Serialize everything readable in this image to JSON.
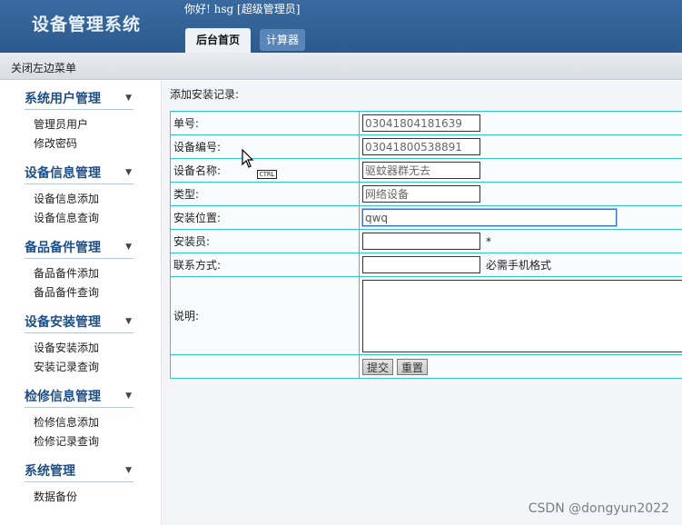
{
  "header": {
    "app_title": "设备管理系统",
    "greeting": "你好! hsg [超级管理员]",
    "tabs": [
      {
        "label": "后台首页"
      },
      {
        "label": "计算器"
      }
    ]
  },
  "toolbar": {
    "toggle_menu": "关闭左边菜单"
  },
  "sidebar": {
    "groups": [
      {
        "title": "系统用户管理",
        "items": [
          "管理员用户",
          "修改密码"
        ]
      },
      {
        "title": "设备信息管理",
        "items": [
          "设备信息添加",
          "设备信息查询"
        ]
      },
      {
        "title": "备品备件管理",
        "items": [
          "备品备件添加",
          "备品备件查询"
        ]
      },
      {
        "title": "设备安装管理",
        "items": [
          "设备安装添加",
          "安装记录查询"
        ]
      },
      {
        "title": "检修信息管理",
        "items": [
          "检修信息添加",
          "检修记录查询"
        ]
      },
      {
        "title": "系统管理",
        "items": [
          "数据备份"
        ]
      }
    ],
    "arrow": "▼"
  },
  "main": {
    "section_title": "添加安装记录:",
    "form": {
      "order_no": {
        "label": "单号:",
        "value": "03041804181639"
      },
      "device_no": {
        "label": "设备编号:",
        "value": "03041800538891"
      },
      "device_name": {
        "label": "设备名称:",
        "value": "驱蚊器群无去"
      },
      "type": {
        "label": "类型:",
        "value": "网络设备"
      },
      "location": {
        "label": "安装位置:",
        "value": "qwq"
      },
      "installer": {
        "label": "安装员:",
        "value": "",
        "required_mark": "*"
      },
      "contact": {
        "label": "联系方式:",
        "value": "",
        "hint": "必需手机格式"
      },
      "remark": {
        "label": "说明:",
        "value": ""
      }
    },
    "buttons": {
      "submit": "提交",
      "reset": "重置"
    }
  },
  "overlay": {
    "ctrl_tag": "CTRL"
  },
  "watermark": "CSDN @dongyun2022"
}
